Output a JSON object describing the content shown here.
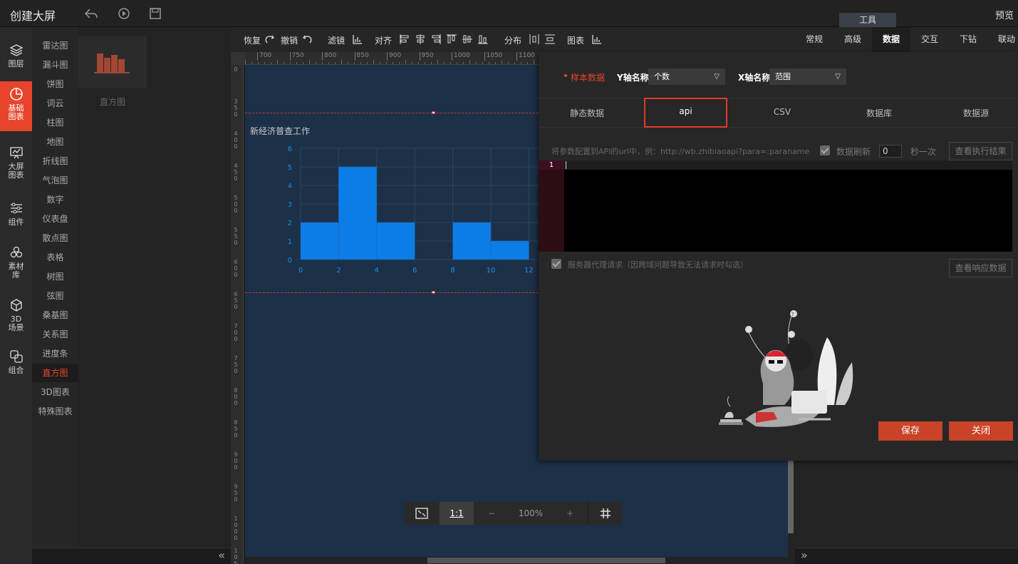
{
  "header": {
    "title": "创建大屏",
    "preview": "预览",
    "tools_tab": "工具"
  },
  "rail": [
    {
      "label": "图层",
      "icon": "layers-icon"
    },
    {
      "label": "基础\n图表",
      "icon": "pie-chart-icon",
      "active": true
    },
    {
      "label": "大屏\n图表",
      "icon": "presentation-chart-icon"
    },
    {
      "label": "组件",
      "icon": "sliders-icon"
    },
    {
      "label": "素材\n库",
      "icon": "hexagons-icon"
    },
    {
      "label": "3D\n场景",
      "icon": "cube-icon"
    },
    {
      "label": "组合",
      "icon": "combine-icon"
    }
  ],
  "categories": [
    "雷达图",
    "漏斗图",
    "饼图",
    "词云",
    "柱图",
    "地图",
    "折线图",
    "气泡图",
    "数字",
    "仪表盘",
    "散点图",
    "表格",
    "树图",
    "弦图",
    "桑基图",
    "关系图",
    "进度条",
    "直方图",
    "3D图表",
    "特殊图表"
  ],
  "active_category": "直方图",
  "thumb_label": "直方图",
  "toolbar": {
    "redo": "恢复",
    "undo": "撤销",
    "filter": "滤镜",
    "align": "对齐",
    "distribute": "分布",
    "chart": "图表"
  },
  "right_tabs": [
    "常规",
    "高级",
    "数据",
    "交互",
    "下钻",
    "联动"
  ],
  "active_right_tab": "数据",
  "ruler_h": [
    "700",
    "750",
    "800",
    "850",
    "900",
    "950",
    "1000",
    "1050",
    "1100"
  ],
  "ruler_v": [
    "0",
    "350",
    "400",
    "450",
    "500",
    "550",
    "600",
    "650",
    "700",
    "750",
    "800",
    "850",
    "900",
    "950",
    "1000",
    "1050"
  ],
  "chart_data": {
    "type": "bar",
    "title": "新经济普查工作",
    "x": [
      0,
      2,
      4,
      6,
      8,
      10,
      12
    ],
    "bins": [
      [
        0,
        2
      ],
      [
        2,
        4
      ],
      [
        4,
        6
      ],
      [
        6,
        8
      ],
      [
        8,
        10
      ],
      [
        10,
        12
      ]
    ],
    "values": [
      2,
      5,
      2,
      0,
      2,
      1
    ],
    "ylim": [
      0,
      6
    ],
    "yticks": [
      "0",
      "1",
      "2",
      "3",
      "4",
      "5",
      "6"
    ],
    "xticks": [
      "0",
      "2",
      "4",
      "6",
      "8",
      "10",
      "12"
    ],
    "grid": true,
    "colors": {
      "bar": "#0d7de6",
      "axis": "#1a8fe0"
    }
  },
  "zoom": {
    "ratio_label": "1:1",
    "minus": "−",
    "value": "100%",
    "plus": "+"
  },
  "dialog": {
    "sample_label": "样本数据",
    "y_label": "Y轴名称",
    "y_value": "个数",
    "x_label": "X轴名称",
    "x_value": "范围",
    "sources": [
      "静态数据",
      "api",
      "CSV",
      "数据库",
      "数据源"
    ],
    "active_source": "api",
    "url_hint": "将参数配置到API的url中，例：http://wb.zhibiaoapi?para=:paraname",
    "refresh_label": "数据刷新",
    "refresh_value": "0",
    "seconds_label": "秒一次",
    "view_exec": "查看执行结果",
    "line_number": "1",
    "proxy_label": "服务器代理请求（因跨域问题导致无法请求时勾选）",
    "view_response": "查看响应数据",
    "save": "保存",
    "close": "关闭"
  },
  "colors": {
    "accent": "#e8442c",
    "canvas": "#1c3048"
  }
}
